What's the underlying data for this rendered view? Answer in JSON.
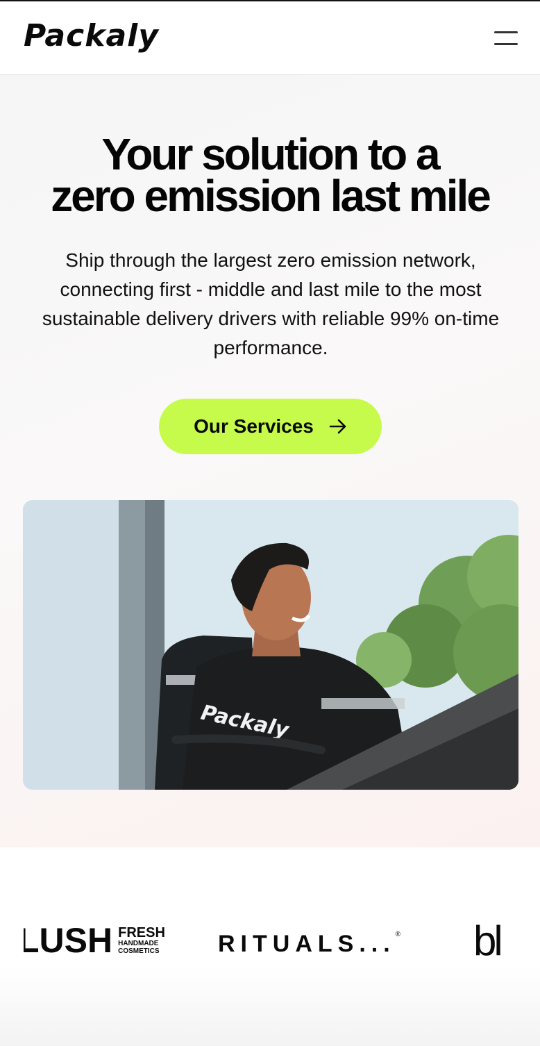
{
  "header": {
    "logo_text": "Packaly",
    "menu_icon": "hamburger-menu-icon"
  },
  "hero": {
    "headline_line1": "Your solution to a",
    "headline_line2": "zero emission last mile",
    "subtitle": "Ship through the largest zero emission network, connecting first - middle and last mile to the most sustainable delivery drivers with reliable 99% on-time performance.",
    "cta_label": "Our Services",
    "cta_icon": "arrow-right-icon",
    "photo_shirt_text": "Packaly"
  },
  "partners": {
    "lush_main": "LUSH",
    "lush_sub1": "FRESH",
    "lush_sub2": "HANDMADE",
    "lush_sub3": "COSMETICS",
    "rituals": "RITUALS...",
    "rituals_mark": "®",
    "partial_brand": "bl"
  },
  "colors": {
    "accent": "#c6fb4b",
    "text": "#0a0a0a"
  }
}
